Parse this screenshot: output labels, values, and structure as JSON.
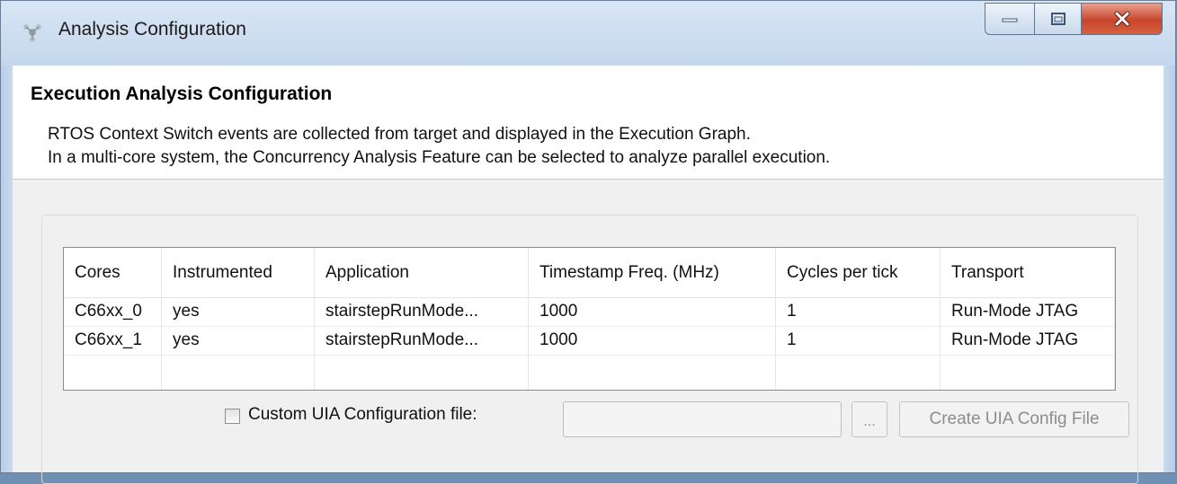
{
  "window": {
    "title": "Analysis Configuration",
    "controls": {
      "minimize": "minimize",
      "maximize": "maximize",
      "close": "close"
    }
  },
  "header": {
    "title": "Execution Analysis Configuration",
    "description_lines": [
      "RTOS Context Switch events are collected from target and displayed in the Execution Graph.",
      "In a multi-core system, the Concurrency Analysis Feature can be selected to analyze parallel execution."
    ]
  },
  "table": {
    "columns": [
      "Cores",
      "Instrumented",
      "Application",
      "Timestamp Freq. (MHz)",
      "Cycles per tick",
      "Transport"
    ],
    "rows": [
      [
        "C66xx_0",
        "yes",
        "stairstepRunMode...",
        "1000",
        "1",
        "Run-Mode JTAG"
      ],
      [
        "C66xx_1",
        "yes",
        "stairstepRunMode...",
        "1000",
        "1",
        "Run-Mode JTAG"
      ],
      [
        "",
        "",
        "",
        "",
        "",
        ""
      ]
    ]
  },
  "custom_config": {
    "checkbox_label": "Custom UIA Configuration file:",
    "checked": false,
    "path_value": "",
    "browse_label": "...",
    "create_label": "Create UIA Config File"
  },
  "colors": {
    "window_frame": "#c9daee",
    "close_button": "#c8452c",
    "content_bg": "#f0f0f0",
    "header_bg": "#ffffff"
  },
  "icons": {
    "app": "analysis-app-icon",
    "minimize": "minimize-icon",
    "maximize": "maximize-icon",
    "close": "close-icon"
  }
}
